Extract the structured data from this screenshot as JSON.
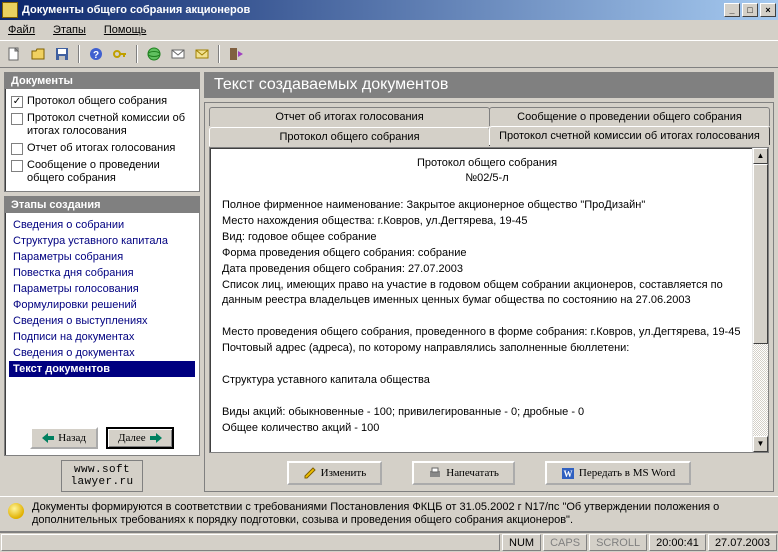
{
  "window": {
    "title": "Документы общего собрания акционеров"
  },
  "menu": {
    "file": "Файл",
    "stages": "Этапы",
    "help": "Помощь"
  },
  "side": {
    "docs_hd": "Документы",
    "docs": [
      {
        "label": "Протокол общего собрания",
        "checked": true
      },
      {
        "label": "Протокол счетной комиссии об итогах голосования",
        "checked": false
      },
      {
        "label": "Отчет об итогах голосования",
        "checked": false
      },
      {
        "label": "Сообщение о проведении общего собрания",
        "checked": false
      }
    ],
    "steps_hd": "Этапы создания",
    "steps": [
      "Сведения о собрании",
      "Структура уставного капитала",
      "Параметры собрания",
      "Повестка дня собрания",
      "Параметры голосования",
      "Формулировки решений",
      "Сведения о выступлениях",
      "Подписи на документах",
      "Сведения о документах",
      "Текст документов"
    ],
    "steps_selected": 9,
    "back": "Назад",
    "next": "Далее",
    "link1": "www.soft",
    "link2": "lawyer.ru"
  },
  "content": {
    "header": "Текст создаваемых документов",
    "tabs_back": [
      "Отчет об итогах голосования",
      "Сообщение о проведении общего собрания"
    ],
    "tabs_front": [
      "Протокол общего собрания",
      "Протокол счетной комиссии об итогах голосования"
    ],
    "tabs_front_active": 0,
    "doc_title_1": "Протокол общего собрания",
    "doc_title_2": "№02/5-л",
    "lines": [
      "Полное фирменное наименование: Закрытое акционерное общество \"ПроДизайн\"",
      "Место нахождения общества: г.Ковров, ул.Дегтярева, 19-45",
      "Вид: годовое общее собрание",
      "Форма проведения общего собрания: собрание",
      "Дата проведения общего собрания: 27.07.2003",
      "Список лиц, имеющих право на участие в годовом общем собрании акционеров, составляется по данным реестра владельцев именных ценных бумаг общества по состоянию на 27.06.2003",
      "",
      "Место проведения общего собрания, проведенного в форме собрания: г.Ковров, ул.Дегтярева, 19-45",
      "Почтовый адрес (адреса), по которому направлялись заполненные бюллетени:",
      "",
      "Структура уставного капитала общества",
      "",
      "Виды акций: обыкновенные - 100; привилегированные - 0; дробные - 0",
      "Общее количество акций - 100"
    ],
    "btn_edit": "Изменить",
    "btn_print": "Напечатать",
    "btn_word": "Передать в MS Word"
  },
  "hint": "Документы формируются в соответствии с требованиями Постановления ФКЦБ от 31.05.2002 г N17/пс \"Об утверждении положения о дополнительных требованиях к порядку подготовки, созыва и проведения общего собрания акционеров\".",
  "status": {
    "num": "NUM",
    "caps": "CAPS",
    "scroll": "SCROLL",
    "time": "20:00:41",
    "date": "27.07.2003"
  }
}
